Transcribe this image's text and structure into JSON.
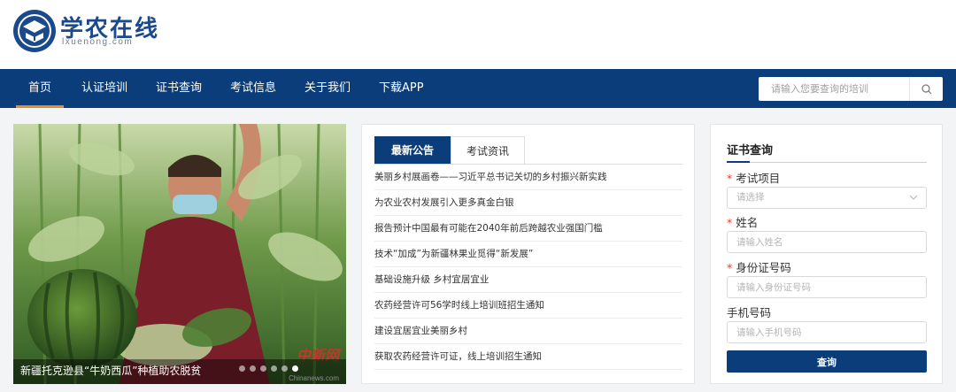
{
  "logo": {
    "title": "学农在线",
    "subtitle": "lxuenong.com",
    "emblem_icon": "university-shield-emblem"
  },
  "nav": {
    "items": [
      {
        "label": "首页",
        "active": true
      },
      {
        "label": "认证培训",
        "active": false
      },
      {
        "label": "证书查询",
        "active": false
      },
      {
        "label": "考试信息",
        "active": false
      },
      {
        "label": "关于我们",
        "active": false
      },
      {
        "label": "下载APP",
        "active": false
      }
    ],
    "accent_color": "#f08a24",
    "bg_color": "#0b3d7a"
  },
  "search": {
    "placeholder": "请输入您要查询的培训",
    "icon": "search-icon"
  },
  "carousel": {
    "caption": "新疆托克逊县“牛奶西瓜”种植助农脱贫",
    "watermark": "中新网",
    "watermark_sub": "Chinanews.com",
    "slide_count": 6,
    "active_slide": 6
  },
  "news": {
    "tabs": [
      {
        "label": "最新公告",
        "active": true
      },
      {
        "label": "考试资讯",
        "active": false
      }
    ],
    "items": [
      "美丽乡村展画卷——习近平总书记关切的乡村振兴新实践",
      "为农业农村发展引入更多真金白银",
      "报告预计中国最有可能在2040年前后跨越农业强国门槛",
      "技术“加成”为新疆林果业觅得“新发展”",
      "基础设施升级 乡村宜居宜业",
      "农药经营许可56学时线上培训班招生通知",
      "建设宜居宜业美丽乡村",
      "获取农药经营许可证，线上培训招生通知"
    ]
  },
  "query": {
    "title": "证书查询",
    "fields": [
      {
        "label": "考试项目",
        "required": true,
        "type": "select",
        "placeholder": "请选择"
      },
      {
        "label": "姓名",
        "required": true,
        "type": "text",
        "placeholder": "请输入姓名"
      },
      {
        "label": "身份证号码",
        "required": true,
        "type": "text",
        "placeholder": "请输入身份证号码"
      },
      {
        "label": "手机号码",
        "required": false,
        "type": "text",
        "placeholder": "请输入手机号码"
      }
    ],
    "submit_label": "查询"
  }
}
